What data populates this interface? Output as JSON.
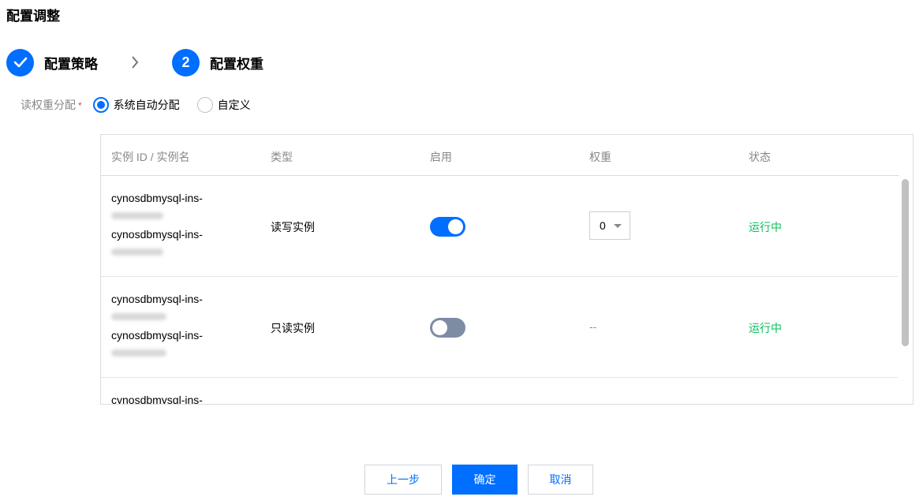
{
  "page": {
    "title": "配置调整"
  },
  "steps": [
    {
      "label": "配置策略",
      "state": "done"
    },
    {
      "number": "2",
      "label": "配置权重",
      "state": "active"
    }
  ],
  "form": {
    "label": "读权重分配",
    "required_mark": "*",
    "options": [
      {
        "label": "系统自动分配",
        "checked": true
      },
      {
        "label": "自定义",
        "checked": false
      }
    ]
  },
  "table": {
    "headers": [
      "实例 ID / 实例名",
      "类型",
      "启用",
      "权重",
      "状态"
    ],
    "rows": [
      {
        "id": "cynosdbmysql-ins-",
        "name": "cynosdbmysql-ins-",
        "type": "读写实例",
        "enabled": true,
        "weight": "0",
        "status": "运行中"
      },
      {
        "id": "cynosdbmysql-ins-",
        "name": "cynosdbmysql-ins-",
        "type": "只读实例",
        "enabled": false,
        "weight": "--",
        "status": "运行中"
      },
      {
        "id": "cynosdbmysql-ins-"
      }
    ]
  },
  "buttons": {
    "prev": "上一步",
    "confirm": "确定",
    "cancel": "取消"
  },
  "colors": {
    "accent": "#006eff",
    "running": "#0abf5b",
    "dash": "#ff7200",
    "toggle_off": "#7d8ca3"
  }
}
